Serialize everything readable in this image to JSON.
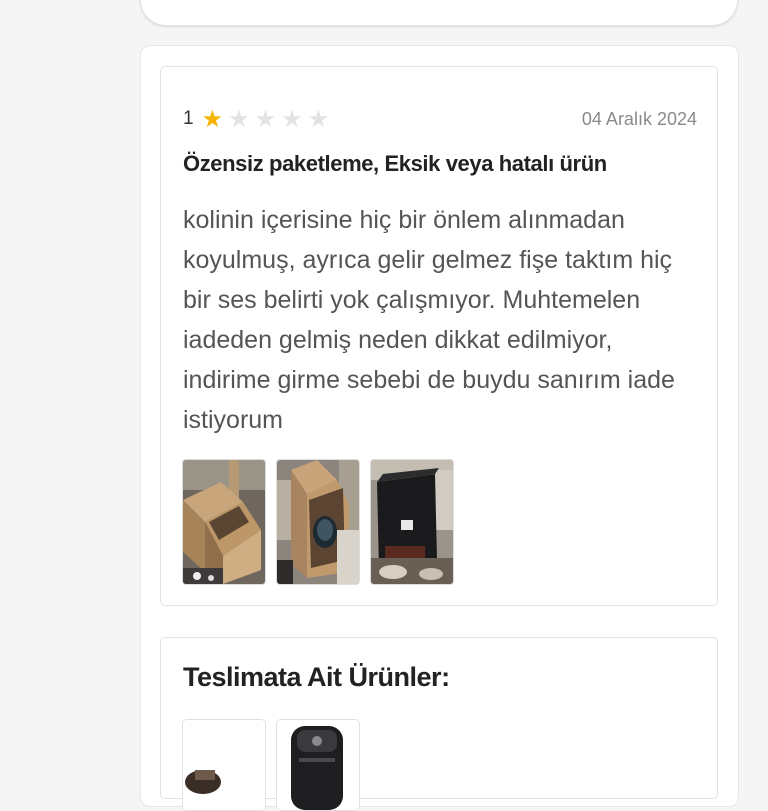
{
  "review": {
    "rating": "1",
    "stars_filled": 1,
    "stars_total": 5,
    "date": "04 Aralık 2024",
    "title": "Özensiz paketleme, Eksik veya hatalı ürün",
    "body": "kolinin içerisine hiç bir önlem alınmadan koyulmuş, ayrıca gelir gelmez fişe taktım hiç bir ses belirti yok çalışmıyor. Muhtemelen iadeden gelmiş neden dikkat edilmiyor, indirime girme sebebi de buydu sanırım iade istiyorum",
    "photos": [
      "open-box-photo",
      "box-with-product-photo",
      "product-packaging-photo"
    ]
  },
  "delivery": {
    "title": "Teslimata Ait Ürünler:",
    "products": [
      "product-thumbnail-1",
      "product-thumbnail-2"
    ]
  },
  "colors": {
    "star_filled": "#f5b400",
    "star_empty": "#e3e3e3",
    "page_background": "#f5f5f5"
  }
}
